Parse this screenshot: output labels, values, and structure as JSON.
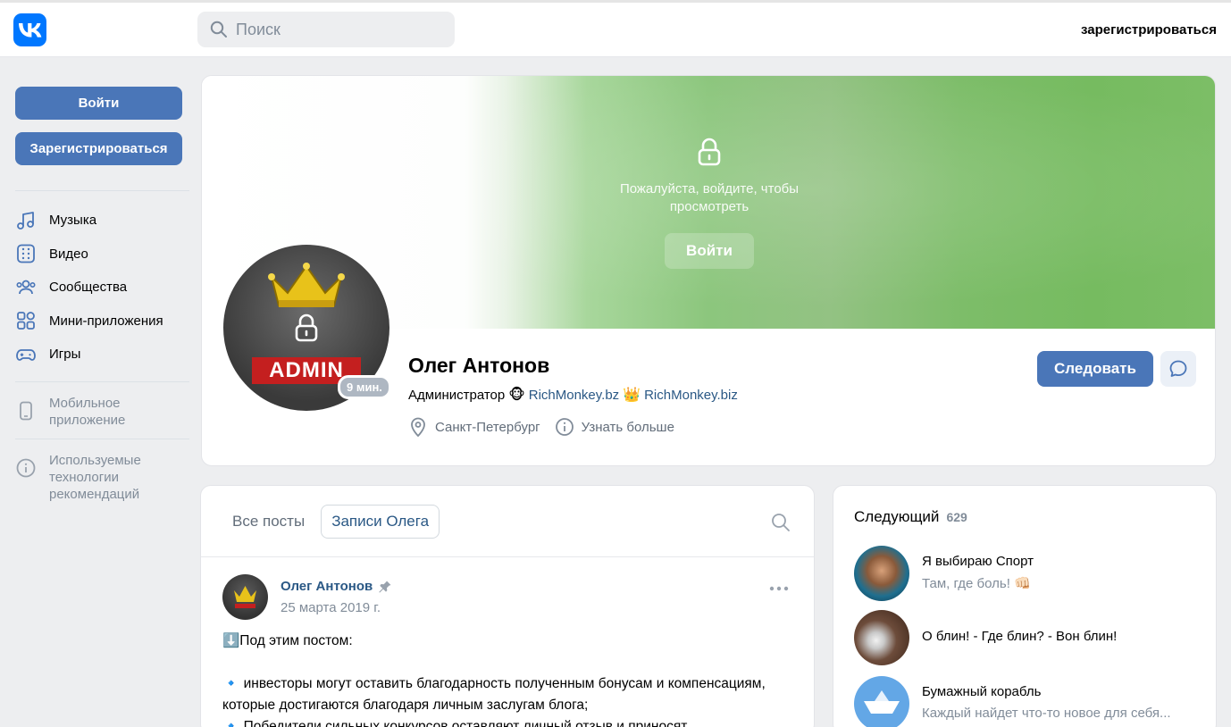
{
  "header": {
    "search_placeholder": "Поиск",
    "register_link": "зарегистрироваться"
  },
  "sidebar": {
    "login_button": "Войти",
    "register_button": "Зарегистрироваться",
    "items": [
      {
        "label": "Музыка",
        "icon": "music-icon"
      },
      {
        "label": "Видео",
        "icon": "video-icon"
      },
      {
        "label": "Сообщества",
        "icon": "communities-icon"
      },
      {
        "label": "Мини-приложения",
        "icon": "mini-apps-icon"
      },
      {
        "label": "Игры",
        "icon": "games-icon"
      }
    ],
    "mobile_app": "Мобильное приложение",
    "recommendation_tech": "Используемые технологии рекомендаций"
  },
  "profile": {
    "cover_message": "Пожалуйста, войдите, чтобы просмотреть",
    "cover_login": "Войти",
    "avatar_text": "ADMIN",
    "online_badge": "9 мин.",
    "name": "Олег Антонов",
    "status_prefix": "Администратор",
    "status_emoji_1": "🐵",
    "status_link_1": "RichMonkey.bz",
    "status_emoji_2": "👑",
    "status_link_2": "RichMonkey.biz",
    "city": "Санкт-Петербург",
    "more_info": "Узнать больше",
    "follow_button": "Следовать"
  },
  "posts": {
    "tabs": [
      "Все посты",
      "Записи Олега"
    ],
    "active_tab": "Записи Олега",
    "author": "Олег Антонов",
    "date": "25 марта 2019 г.",
    "line1": "⬇️Под этим постом:",
    "line2": "🔹 инвесторы могут оставить благодарность полученным бонусам и компенсациям, которые достигаются благодаря личным заслугам блога;",
    "line3": "🔹 Победители сильных конкурсов оставляют личный отзыв и приносят"
  },
  "following": {
    "title": "Следующий",
    "count": "629",
    "items": [
      {
        "name": "Я выбираю Спорт",
        "sub": "Там, где боль! 👊🏻"
      },
      {
        "name": "О блин! - Где блин? - Вон блин!",
        "sub": ""
      },
      {
        "name": "Бумажный корабль",
        "sub": "Каждый найдет что-то новое для себя..."
      }
    ]
  },
  "colors": {
    "accent": "#4a76b8",
    "link": "#2a5885",
    "vk_blue": "#0077ff",
    "background": "#edeef0"
  }
}
